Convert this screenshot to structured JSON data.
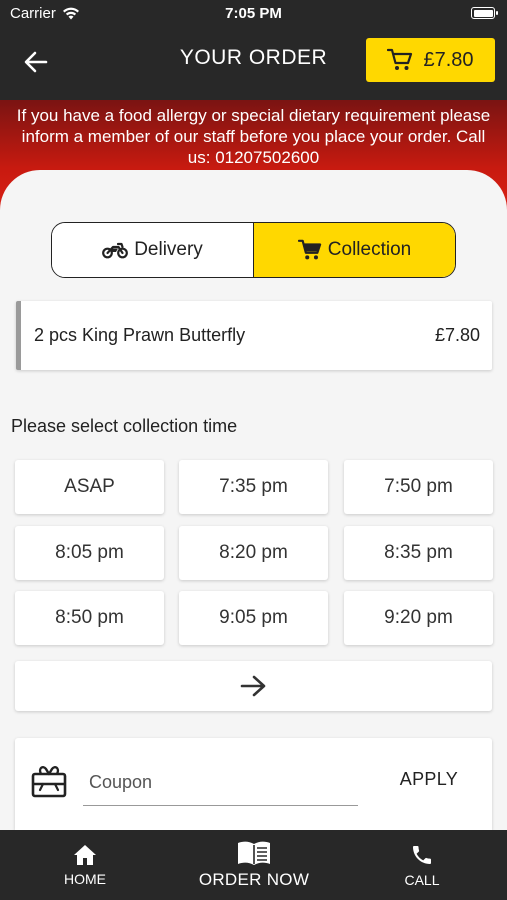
{
  "status_bar": {
    "carrier": "Carrier",
    "time": "7:05 PM"
  },
  "header": {
    "title": "YOUR ORDER",
    "cart_total": "£7.80",
    "back_icon": "arrow-left-icon",
    "cart_icon": "cart-icon"
  },
  "allergy_notice": "If you have a food allergy or special dietary requirement please inform a member of our staff before you place your order. Call us: 01207502600",
  "order_type": {
    "delivery_label": "Delivery",
    "collection_label": "Collection",
    "selected": "Collection"
  },
  "order_items": [
    {
      "name": "2 pcs King Prawn Butterfly",
      "price": "£7.80"
    }
  ],
  "collection": {
    "label": "Please select collection time",
    "slots": [
      "ASAP",
      "7:35 pm",
      "7:50 pm",
      "8:05 pm",
      "8:20 pm",
      "8:35 pm",
      "8:50 pm",
      "9:05 pm",
      "9:20 pm"
    ],
    "next_icon": "arrow-right-icon"
  },
  "coupon": {
    "placeholder": "Coupon",
    "apply_label": "APPLY",
    "icon": "gift-icon"
  },
  "bottom_nav": {
    "home_label": "HOME",
    "order_now_label": "ORDER NOW",
    "call_label": "CALL"
  },
  "colors": {
    "accent": "#ffd800",
    "dark": "#282828",
    "banner_red": "#c81a10"
  }
}
